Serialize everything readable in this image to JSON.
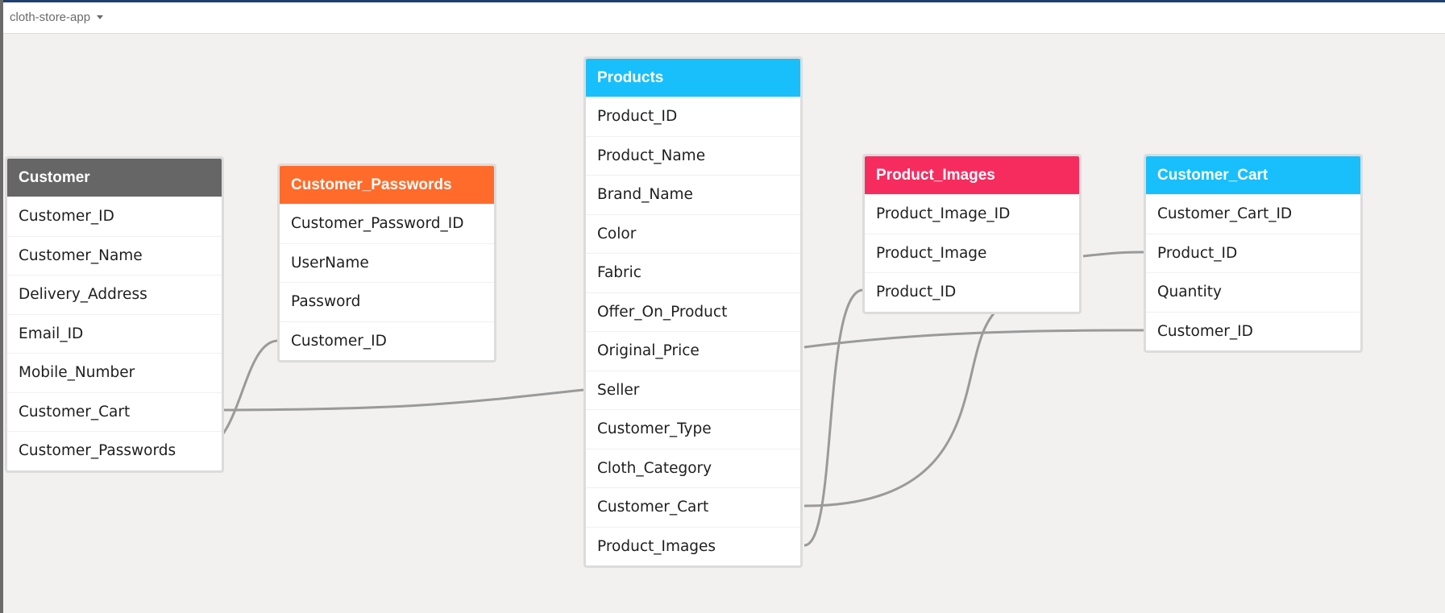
{
  "app": {
    "name": "cloth-store-app"
  },
  "colors": {
    "customer": "#666666",
    "customer_passwords": "#ff6b2b",
    "products": "#18bffb",
    "product_images": "#f62c5f",
    "customer_cart": "#18bffb",
    "link": "#9a9a9a"
  },
  "tables": {
    "customer": {
      "name": "Customer",
      "fields": [
        "Customer_ID",
        "Customer_Name",
        "Delivery_Address",
        "Email_ID",
        "Mobile_Number",
        "Customer_Cart",
        "Customer_Passwords"
      ]
    },
    "customer_passwords": {
      "name": "Customer_Passwords",
      "fields": [
        "Customer_Password_ID",
        "UserName",
        "Password",
        "Customer_ID"
      ]
    },
    "products": {
      "name": "Products",
      "fields": [
        "Product_ID",
        "Product_Name",
        "Brand_Name",
        "Color",
        "Fabric",
        "Offer_On_Product",
        "Original_Price",
        "Seller",
        "Customer_Type",
        "Cloth_Category",
        "Customer_Cart",
        "Product_Images"
      ]
    },
    "product_images": {
      "name": "Product_Images",
      "fields": [
        "Product_Image_ID",
        "Product_Image",
        "Product_ID"
      ]
    },
    "customer_cart": {
      "name": "Customer_Cart",
      "fields": [
        "Customer_Cart_ID",
        "Product_ID",
        "Quantity",
        "Customer_ID"
      ]
    }
  }
}
